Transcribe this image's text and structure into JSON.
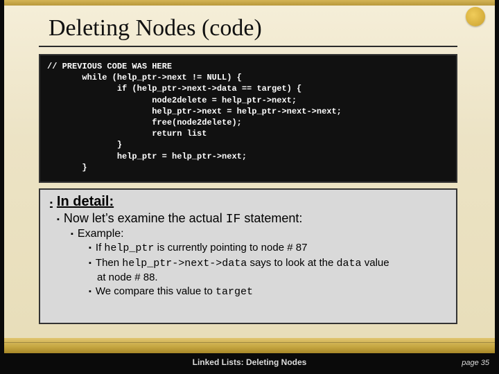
{
  "title": "Deleting Nodes (code)",
  "code": {
    "l1": "// PREVIOUS CODE WAS HERE",
    "l2": "       while (help_ptr->next != NULL) {",
    "l3": "              if (help_ptr->next->data == target) {",
    "l4": "                     node2delete = help_ptr->next;",
    "l5": "                     help_ptr->next = help_ptr->next->next;",
    "l6": "                     free(node2delete);",
    "l7": "                     return list",
    "l8": "              }",
    "l9": "              help_ptr = help_ptr->next;",
    "l10": "       }"
  },
  "detail": {
    "heading": "In detail:",
    "line1_a": "Now let’s examine the actual ",
    "line1_code": "IF",
    "line1_b": " statement:",
    "example_label": "Example:",
    "b1_a": "If ",
    "b1_code": "help_ptr",
    "b1_b": " is currently pointing to node # 87",
    "b2_a": "Then ",
    "b2_code": "help_ptr->next->data",
    "b2_b": " says to look at the ",
    "b2_code2": "data",
    "b2_c": " value",
    "b2_cont": "at node # 88.",
    "b3_a": "We compare this value to ",
    "b3_code": "target"
  },
  "footer": {
    "title": "Linked Lists:  Deleting Nodes",
    "page": "page 35"
  }
}
